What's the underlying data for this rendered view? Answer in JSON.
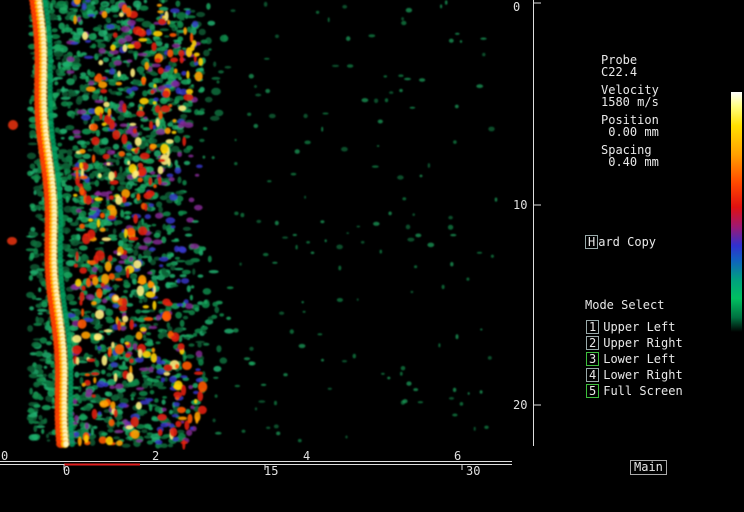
{
  "depth_scale": {
    "labels": [
      "0",
      "10",
      "20"
    ]
  },
  "lateral_scale_top": {
    "labels": [
      "0",
      "2",
      "4",
      "6"
    ]
  },
  "lateral_scale_bottom": {
    "labels": [
      "0",
      "15",
      "30"
    ]
  },
  "info": {
    "probe_label": "Probe",
    "probe_value": "C22.4",
    "velocity_label": "Velocity",
    "velocity_value": "1580 m/s",
    "position_label": "Position",
    "position_value": " 0.00 mm",
    "spacing_label": "Spacing",
    "spacing_value": " 0.40 mm"
  },
  "hard_copy": {
    "key": "H",
    "label": "ard Copy"
  },
  "mode_select": {
    "title": "Mode Select",
    "items": [
      {
        "key": "1",
        "label": "Upper Left"
      },
      {
        "key": "2",
        "label": "Upper Right"
      },
      {
        "key": "3",
        "label": "Lower Left"
      },
      {
        "key": "4",
        "label": "Lower Right"
      },
      {
        "key": "5",
        "label": "Full Screen"
      }
    ]
  },
  "main_button": {
    "label": "Main"
  },
  "colors": {
    "background": "#000000",
    "text": "#e8e8e8",
    "key_border_green": "#3cbf3c",
    "indicator_red": "#e02020"
  },
  "colorbar": {
    "top": "white",
    "bottom": "black",
    "palette": [
      "white",
      "yellow",
      "orange",
      "red",
      "purple",
      "blue",
      "teal",
      "green"
    ]
  }
}
